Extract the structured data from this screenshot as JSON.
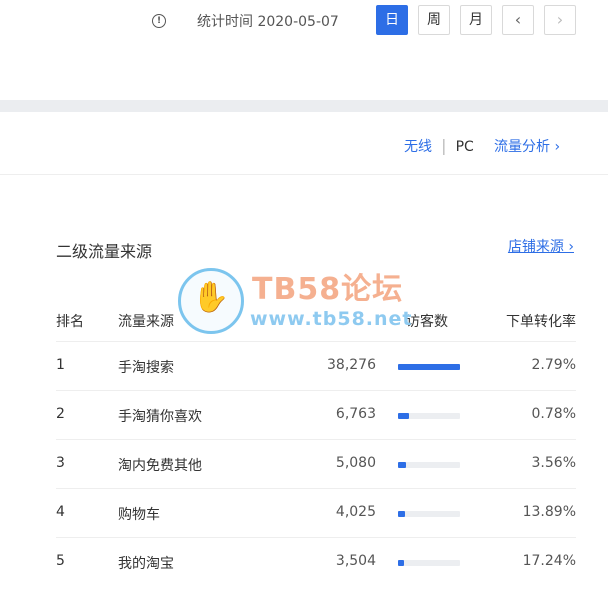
{
  "header": {
    "stat_time_label": "统计时间 2020-05-07",
    "period_buttons": [
      "日",
      "周",
      "月"
    ],
    "active_period": "日",
    "prev_icon": "chevron-left-icon",
    "next_icon": "chevron-right-icon"
  },
  "links": {
    "wireless": "无线",
    "separator": "|",
    "pc": "PC",
    "traffic_analysis": "流量分析 ›"
  },
  "section": {
    "title": "二级流量来源",
    "shop_source": "店铺来源 ›"
  },
  "watermark": {
    "title": "TB58论坛",
    "url": "www.tb58.net"
  },
  "table": {
    "headers": [
      "排名",
      "流量来源",
      "访客数",
      "下单转化率"
    ],
    "rows": [
      {
        "rank": "1",
        "name": "手淘搜索",
        "visits": "38,276",
        "ratio": 1.0,
        "conversion": "2.79%"
      },
      {
        "rank": "2",
        "name": "手淘猜你喜欢",
        "visits": "6,763",
        "ratio": 0.177,
        "conversion": "0.78%"
      },
      {
        "rank": "3",
        "name": "淘内免费其他",
        "visits": "5,080",
        "ratio": 0.133,
        "conversion": "3.56%"
      },
      {
        "rank": "4",
        "name": "购物车",
        "visits": "4,025",
        "ratio": 0.105,
        "conversion": "13.89%"
      },
      {
        "rank": "5",
        "name": "我的淘宝",
        "visits": "3,504",
        "ratio": 0.092,
        "conversion": "17.24%"
      }
    ]
  },
  "colors": {
    "accent": "#2d6ee6",
    "bar_track": "#eceef1"
  }
}
